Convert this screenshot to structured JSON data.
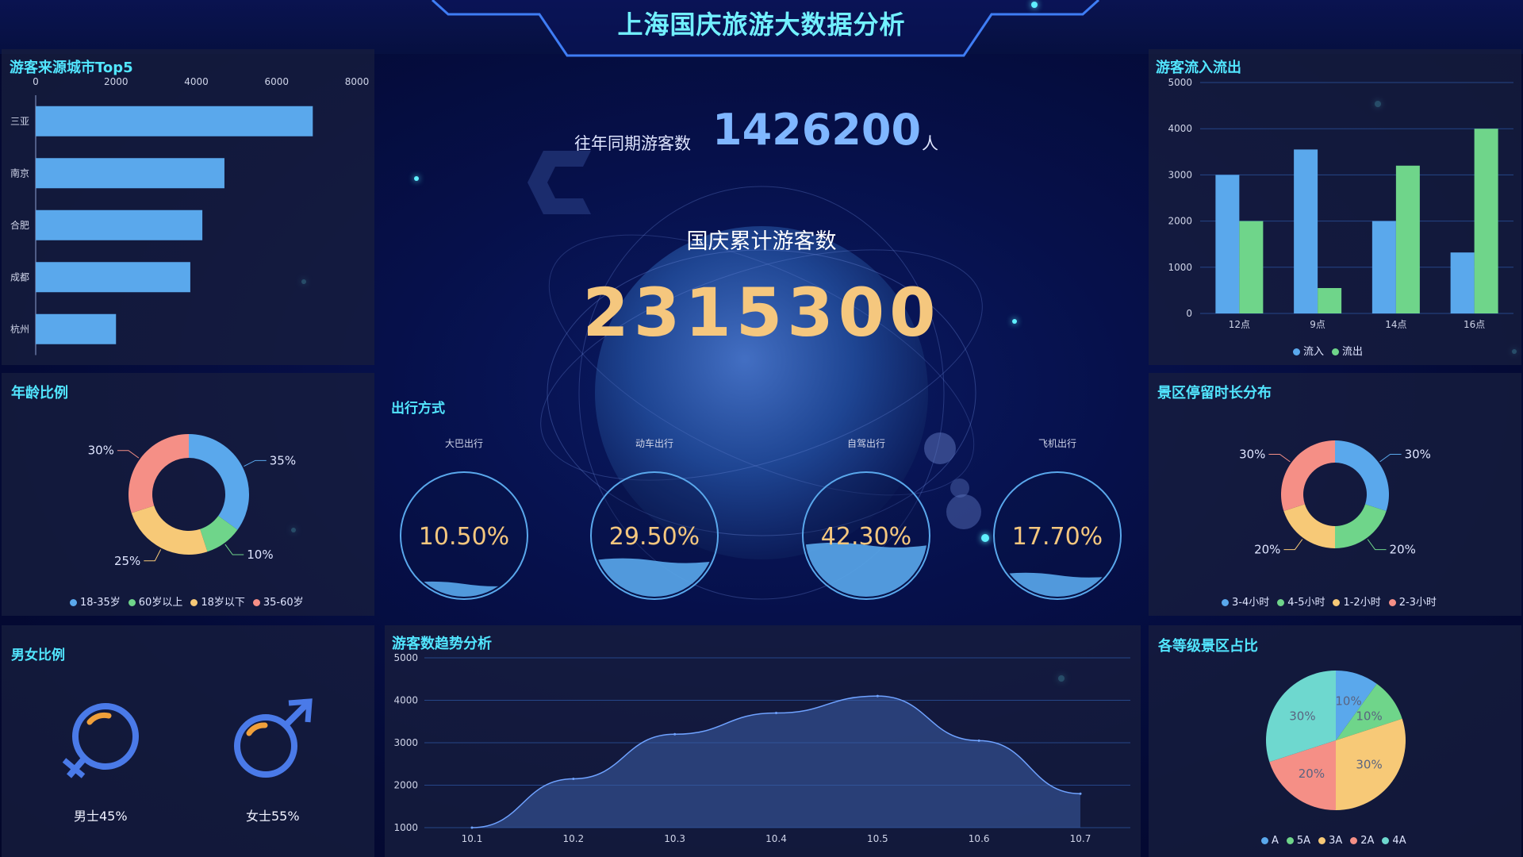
{
  "title": "上海国庆旅游大数据分析",
  "colors": {
    "blue": "#5aa8ec",
    "green": "#6fd58a",
    "yellow": "#f7c977",
    "red": "#f58f86",
    "teal": "#6ed8cf",
    "accent": "#52e6ff",
    "gold": "#f5c77e"
  },
  "center": {
    "prev_label": "往年同期游客数",
    "prev_value": "1426200",
    "prev_unit": "人",
    "total_label": "国庆累计游客数",
    "total_value": "2315300"
  },
  "travel": {
    "title": "出行方式",
    "items": [
      {
        "label": "大巴出行",
        "value": "10.50%",
        "fill": 0.105
      },
      {
        "label": "动车出行",
        "value": "29.50%",
        "fill": 0.295
      },
      {
        "label": "自驾出行",
        "value": "42.30%",
        "fill": 0.423
      },
      {
        "label": "飞机出行",
        "value": "17.70%",
        "fill": 0.177
      }
    ]
  },
  "source_city": {
    "title": "游客来源城市Top5",
    "chart_data": {
      "type": "bar",
      "orientation": "horizontal",
      "categories": [
        "三亚",
        "南京",
        "合肥",
        "成都",
        "杭州"
      ],
      "values": [
        6900,
        4700,
        4150,
        3850,
        2000
      ],
      "xlim": [
        0,
        8000
      ],
      "xticks": [
        "0",
        "2000",
        "4000",
        "6000",
        "8000"
      ]
    }
  },
  "flow": {
    "title": "游客流入流出",
    "chart_data": {
      "type": "bar",
      "categories": [
        "12点",
        "9点",
        "14点",
        "16点"
      ],
      "series": [
        {
          "name": "流入",
          "values": [
            3000,
            3550,
            2000,
            1320
          ]
        },
        {
          "name": "流出",
          "values": [
            2000,
            550,
            3200,
            4000
          ]
        }
      ],
      "ylim": [
        0,
        5000
      ],
      "yticks": [
        "0",
        "1000",
        "2000",
        "3000",
        "4000",
        "5000"
      ],
      "legend": "bottom"
    }
  },
  "age": {
    "title": "年龄比例",
    "chart_data": {
      "type": "pie",
      "labels": [
        "18-35岁",
        "60岁以上",
        "18岁以下",
        "35-60岁"
      ],
      "values": [
        35,
        10,
        25,
        30
      ],
      "value_labels": [
        "35%",
        "10%",
        "25%",
        "30%"
      ],
      "legend": "bottom"
    }
  },
  "stay": {
    "title": "景区停留时长分布",
    "chart_data": {
      "type": "pie",
      "labels": [
        "3-4小时",
        "4-5小时",
        "1-2小时",
        "2-3小时"
      ],
      "values": [
        30,
        20,
        20,
        30
      ],
      "value_labels": [
        "30%",
        "20%",
        "20%",
        "30%"
      ],
      "legend": "bottom"
    }
  },
  "gender": {
    "title": "男女比例",
    "male": {
      "label": "男士45%",
      "value": 45
    },
    "female": {
      "label": "女士55%",
      "value": 55
    }
  },
  "trend": {
    "title": "游客数趋势分析",
    "chart_data": {
      "type": "area",
      "x": [
        "10.1",
        "10.2",
        "10.3",
        "10.4",
        "10.5",
        "10.6",
        "10.7"
      ],
      "values": [
        1000,
        2150,
        3200,
        3700,
        4100,
        3050,
        1800
      ],
      "ylim": [
        1000,
        5000
      ],
      "yticks": [
        "1000",
        "2000",
        "3000",
        "4000",
        "5000"
      ]
    }
  },
  "level": {
    "title": "各等级景区占比",
    "chart_data": {
      "type": "pie",
      "labels": [
        "A",
        "5A",
        "3A",
        "2A",
        "4A"
      ],
      "values": [
        10,
        10,
        30,
        20,
        30
      ],
      "value_labels": [
        "10%",
        "10%",
        "30%",
        "20%",
        "30%"
      ],
      "legend": "bottom"
    }
  }
}
